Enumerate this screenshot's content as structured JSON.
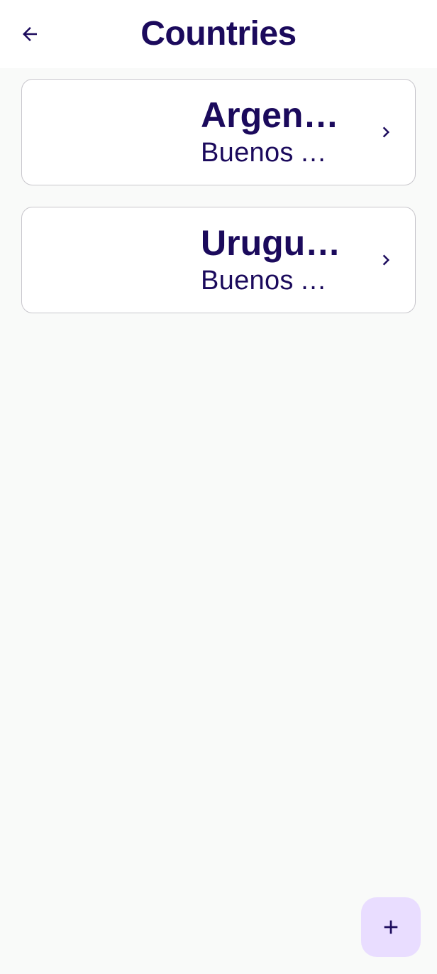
{
  "header": {
    "title": "Countries",
    "back_icon": "arrow-left-icon"
  },
  "countries": [
    {
      "name": "Argentina",
      "capital": "Buenos Aires"
    },
    {
      "name": "Uruguay",
      "capital": "Buenos Aires"
    }
  ],
  "fab": {
    "icon": "plus-icon",
    "color": "#e9ddff"
  },
  "colors": {
    "primary_text": "#1b0a5c",
    "card_border": "#c8c6cc",
    "background": "#f9faf9"
  }
}
